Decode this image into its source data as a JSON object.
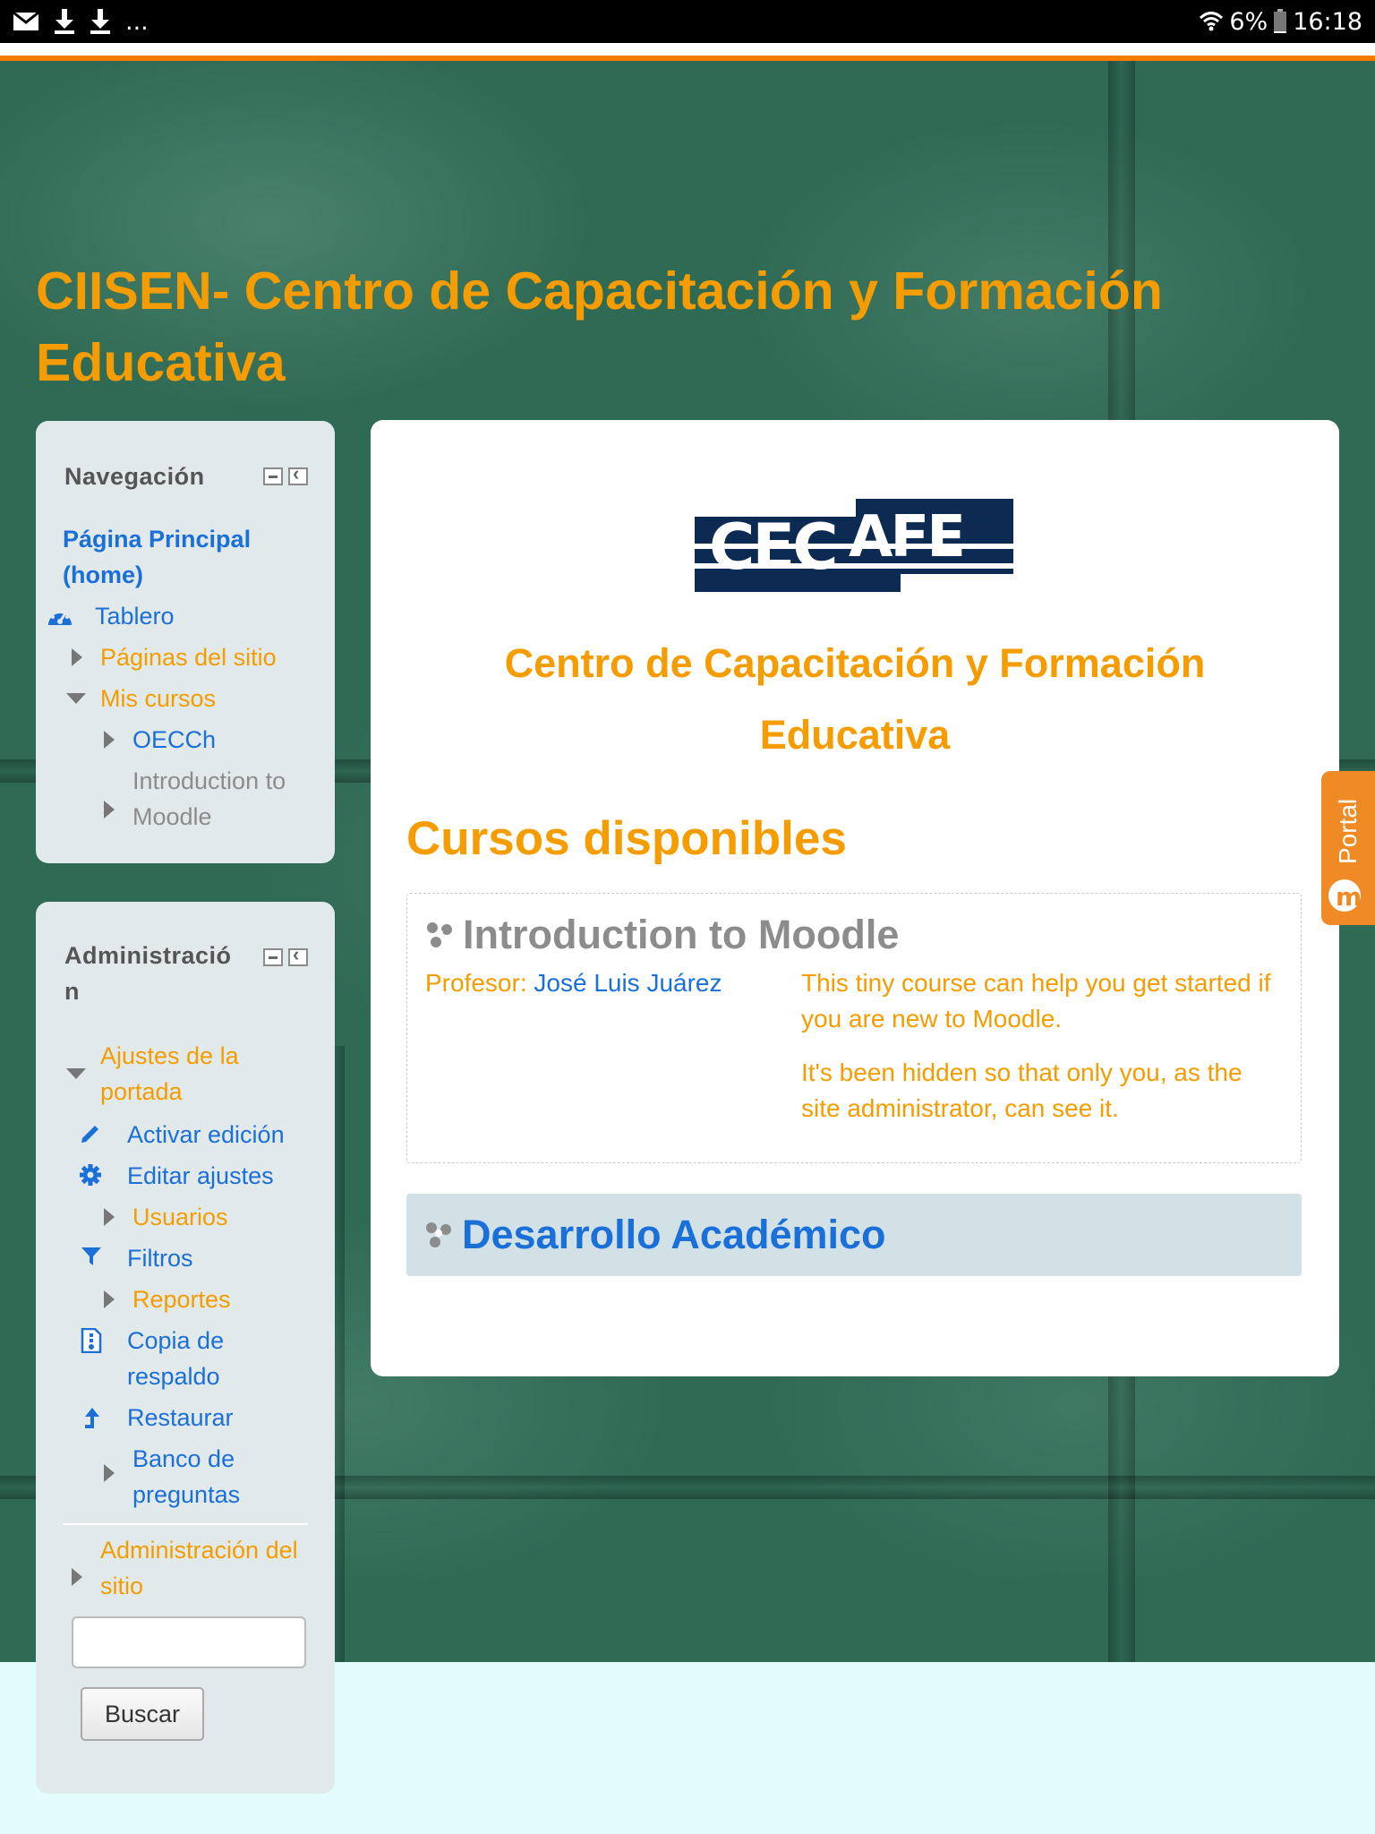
{
  "status_bar": {
    "overflow": "...",
    "battery": "6%",
    "time": "16:18"
  },
  "site": {
    "title": "CIISEN- Centro de Capacitación y Formación Educativa"
  },
  "navigation": {
    "title": "Navegación",
    "home": "Página Principal (home)",
    "dashboard": "Tablero",
    "site_pages": "Páginas del sitio",
    "my_courses": "Mis cursos",
    "course_1": "OECCh",
    "course_2": "Introduction to Moodle"
  },
  "administration": {
    "title": "Administración",
    "frontpage_settings": "Ajustes de la portada",
    "turn_editing_on": "Activar edición",
    "edit_settings": "Editar ajustes",
    "users": "Usuarios",
    "filters": "Filtros",
    "reports": "Reportes",
    "backup": "Copia de respaldo",
    "restore": "Restaurar",
    "question_bank": "Banco de preguntas",
    "site_admin": "Administración del sitio",
    "search_value": "",
    "search_button": "Buscar"
  },
  "main": {
    "logo_text": "CECAFE",
    "headline": "Centro de Capacitación y Formación Educativa",
    "available_courses": "Cursos disponibles",
    "course": {
      "name": "Introduction to Moodle",
      "teacher_label": "Profesor:",
      "teacher_name": "José Luis Juárez",
      "summary_1": "This tiny course can help you get started if you are new to Moodle.",
      "summary_2": "It's been hidden so that only you, as the site administrator, can see it."
    },
    "category": "Desarrollo Académico"
  },
  "portal_tab": {
    "label": "Portal"
  },
  "colors": {
    "accent_orange": "#f59c00",
    "link_blue": "#1a6fd8",
    "board_green": "#2f6a55",
    "block_bg": "#e1e9ea"
  }
}
